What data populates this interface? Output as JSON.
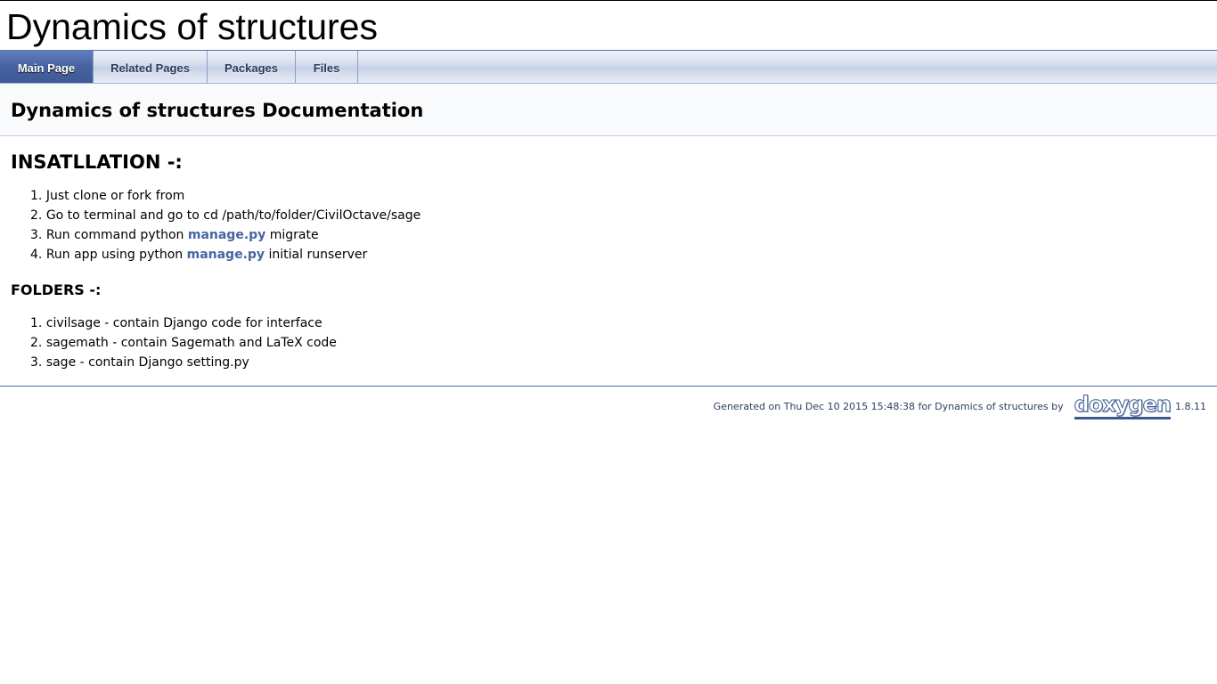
{
  "project": {
    "name": "Dynamics of structures"
  },
  "navigation": {
    "tabs": [
      {
        "label": "Main Page",
        "current": true
      },
      {
        "label": "Related Pages",
        "current": false
      },
      {
        "label": "Packages",
        "current": false
      },
      {
        "label": "Files",
        "current": false
      }
    ]
  },
  "page": {
    "title": "Dynamics of structures Documentation"
  },
  "installation": {
    "heading": "INSATLLATION -:",
    "steps": [
      {
        "number": "1.",
        "text": "Just clone or fork from"
      },
      {
        "number": "2.",
        "text": "Go to terminal and go to cd /path/to/folder/CivilOctave/sage"
      },
      {
        "number": "3.",
        "prefix": "Run command python ",
        "link": "manage.py",
        "suffix": " migrate"
      },
      {
        "number": "4.",
        "prefix": "Run app using python ",
        "link": "manage.py",
        "suffix": " initial runserver"
      }
    ]
  },
  "folders": {
    "heading": "FOLDERS -:",
    "items": [
      {
        "number": "1.",
        "text": "civilsage - contain Django code for interface"
      },
      {
        "number": "2.",
        "text": "sagemath - contain Sagemath and LaTeX code"
      },
      {
        "number": "3.",
        "text": "sage - contain Django setting.py"
      }
    ]
  },
  "footer": {
    "generated_text": "Generated on Thu Dec 10 2015 15:48:38 for Dynamics of structures by",
    "logo_text": "doxygen",
    "version": "1.8.11"
  },
  "colors": {
    "link": "#4665A2",
    "tab_active": "#47629e",
    "footer_text": "#2a3d61"
  }
}
